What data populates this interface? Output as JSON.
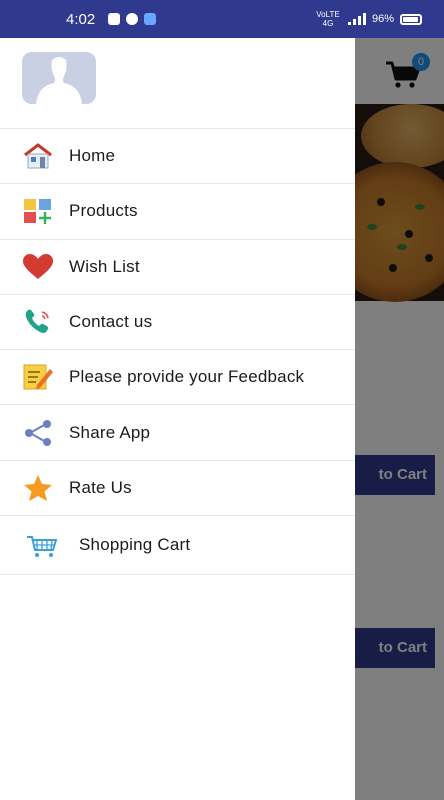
{
  "status_bar": {
    "time": "4:02",
    "network_label": "VoLTE 4G",
    "battery": "96%",
    "icons": [
      "message-icon",
      "chat-icon",
      "cloud-icon",
      "signal-icon",
      "battery-icon"
    ]
  },
  "background_app": {
    "cart_count": "0",
    "buttons": [
      "to Cart",
      "to Cart"
    ]
  },
  "drawer": {
    "avatar": "default-profile-avatar",
    "menu": [
      {
        "label": "Home",
        "icon": "house-icon"
      },
      {
        "label": "Products",
        "icon": "products-grid-icon"
      },
      {
        "label": "Wish List",
        "icon": "heart-icon"
      },
      {
        "label": "Contact us",
        "icon": "phone-icon"
      },
      {
        "label": "Please provide your Feedback",
        "icon": "notepad-pencil-icon"
      },
      {
        "label": "Share App",
        "icon": "share-icon"
      },
      {
        "label": "Rate Us",
        "icon": "star-icon"
      },
      {
        "label": "Shopping Cart",
        "icon": "shopping-cart-icon"
      }
    ]
  },
  "colors": {
    "status_bar": "#2f3a8f",
    "button": "#2f3a8f",
    "badge": "#2196f3",
    "divider": "#e6e6e6"
  }
}
